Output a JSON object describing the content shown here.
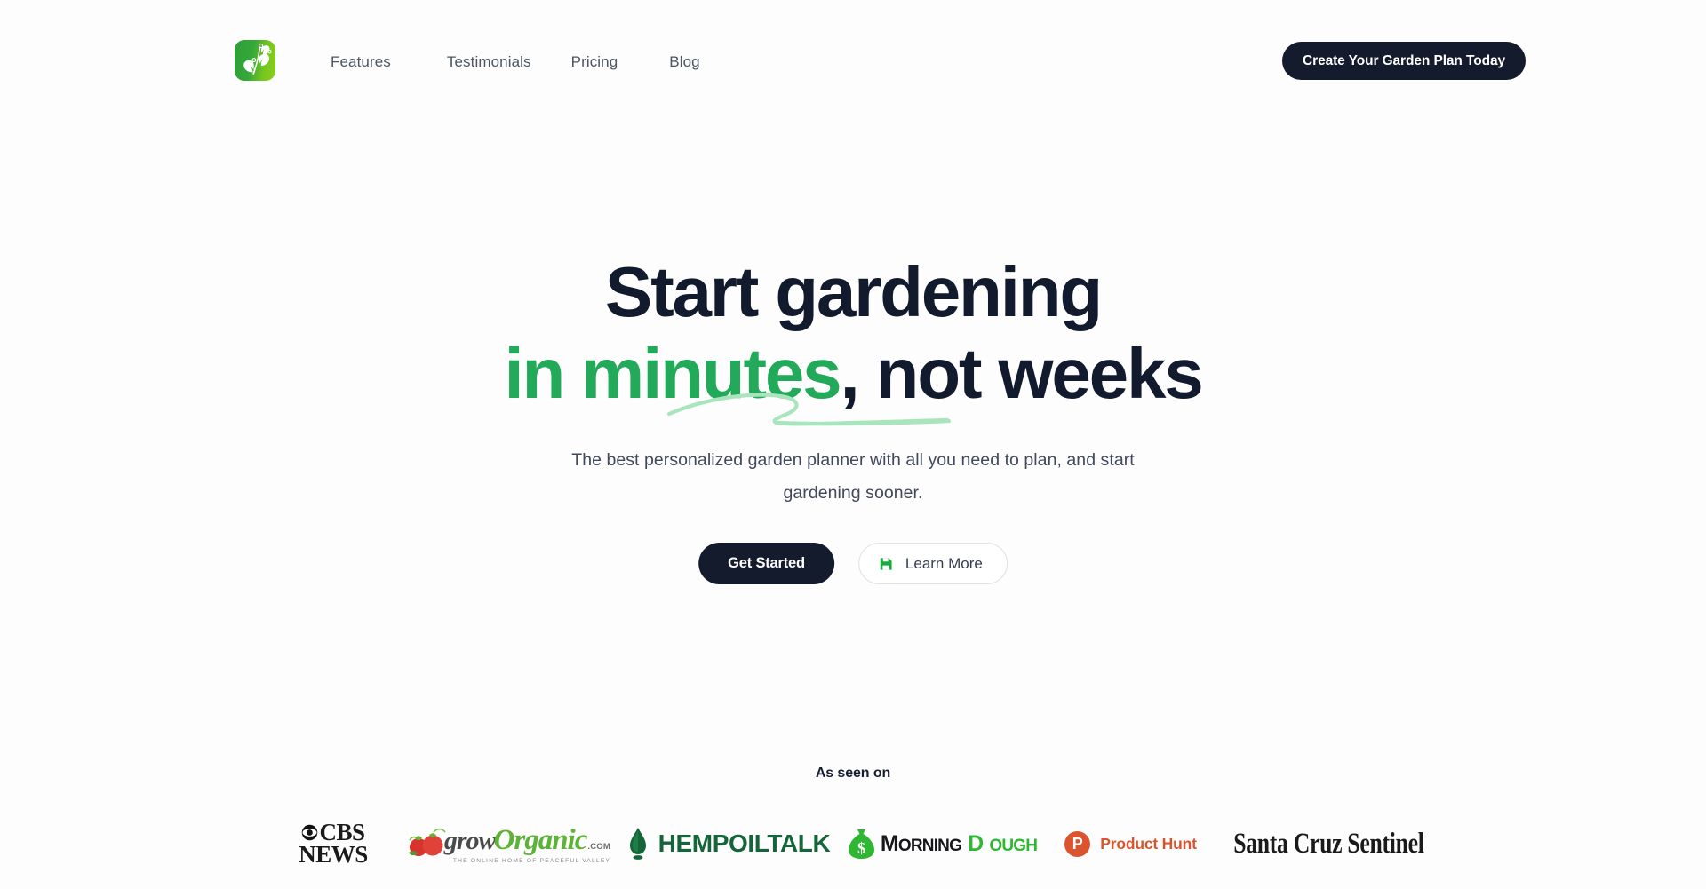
{
  "theme": {
    "background": "#FDFDFD",
    "ink": "#121A2E",
    "accent_green": "#22A95A",
    "accent_green_light": "#A5E3B8",
    "dark_button": "#141B2D",
    "muted_text": "#4B5563"
  },
  "header": {
    "logo_name": "plant-leaf-logo",
    "nav": [
      {
        "label": "Features"
      },
      {
        "label": "Testimonials"
      },
      {
        "label": "Pricing"
      },
      {
        "label": "Blog"
      }
    ],
    "cta_label": "Create Your Garden Plan Today"
  },
  "hero": {
    "headline_line1": "Start gardening",
    "headline_highlight": "in minutes",
    "headline_rest": ", not weeks",
    "subtitle": "The best personalized garden planner with all you need to plan, and start gardening sooner.",
    "primary_button": "Get Started",
    "secondary_button": "Learn More",
    "secondary_icon": "document-icon"
  },
  "social_proof": {
    "label": "As seen on",
    "logos": [
      {
        "name": "cbs-news",
        "word": "CBS",
        "second": "NEWS"
      },
      {
        "name": "grow-organic",
        "grow": "grow",
        "organic": "Organic",
        "com": ".COM",
        "tagline": "THE ONLINE HOME OF PEACEFUL VALLEY"
      },
      {
        "name": "hemp-oil-talk",
        "text": "HEMPOILTALK"
      },
      {
        "name": "morning-dough",
        "morning_m": "M",
        "morning_rest": "ORNING",
        "dough_d": "D",
        "dough_rest": "OUGH"
      },
      {
        "name": "product-hunt",
        "mark": "P",
        "text": "Product Hunt"
      },
      {
        "name": "santa-cruz-sentinel",
        "text": "Santa Cruz Sentinel"
      }
    ]
  }
}
